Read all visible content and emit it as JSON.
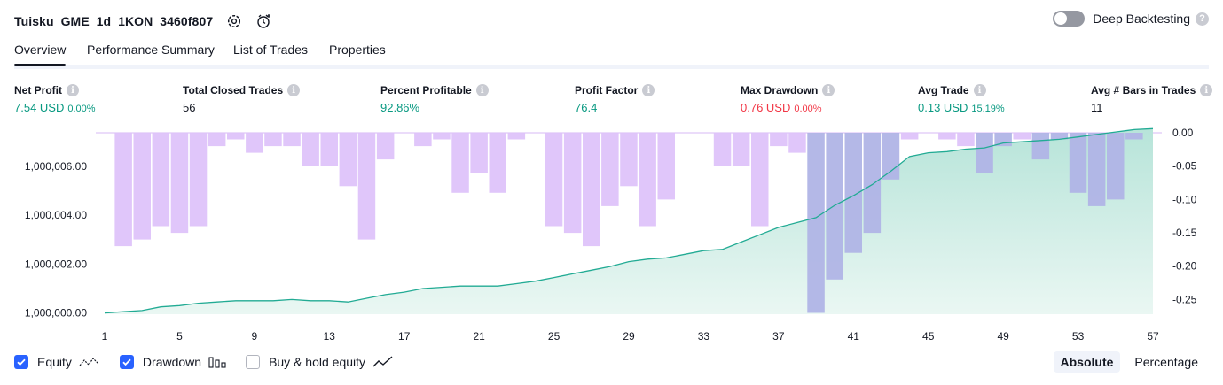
{
  "header": {
    "title": "Tuisku_GME_1d_1KON_3460f807",
    "settings_icon": "gear-icon",
    "replay_icon": "add-alert-clock-icon",
    "deep_backtesting_label": "Deep Backtesting",
    "deep_backtesting_enabled": false,
    "help_icon_text": "?"
  },
  "tabs": [
    {
      "label": "Overview",
      "active": true
    },
    {
      "label": "Performance Summary",
      "active": false
    },
    {
      "label": "List of Trades",
      "active": false
    },
    {
      "label": "Properties",
      "active": false
    }
  ],
  "info_icon_text": "i",
  "metrics": [
    {
      "label": "Net Profit",
      "value": "7.54 USD",
      "pct": "0.00%",
      "color": "green"
    },
    {
      "label": "Total Closed Trades",
      "value": "56",
      "pct": "",
      "color": "dark"
    },
    {
      "label": "Percent Profitable",
      "value": "92.86%",
      "pct": "",
      "color": "green"
    },
    {
      "label": "Profit Factor",
      "value": "76.4",
      "pct": "",
      "color": "green"
    },
    {
      "label": "Max Drawdown",
      "value": "0.76 USD",
      "pct": "0.00%",
      "color": "red"
    },
    {
      "label": "Avg Trade",
      "value": "0.13 USD",
      "pct": "15.19%",
      "color": "green"
    },
    {
      "label": "Avg # Bars in Trades",
      "value": "11",
      "pct": "",
      "color": "dark"
    }
  ],
  "colors": {
    "equity_line": "#22ab94",
    "equity_fill_top": "#b7e4d9",
    "equity_fill_bottom": "#eaf7f3",
    "drawdown_bar": "#dec3fa",
    "drawdown_overlap": "#b0b4e6",
    "accent": "#2962ff",
    "green": "#089981",
    "red": "#f23645"
  },
  "chart_data": {
    "type": "bar+area",
    "x_ticks": [
      "1",
      "5",
      "9",
      "13",
      "17",
      "21",
      "25",
      "29",
      "33",
      "37",
      "41",
      "45",
      "49",
      "53",
      "57"
    ],
    "left_axis": {
      "ticks": [
        "1,000,006.00",
        "1,000,004.00",
        "1,000,002.00",
        "1,000,000.00"
      ],
      "tick_values": [
        1000006,
        1000004,
        1000002,
        1000000
      ],
      "range": [
        999999.95,
        1000007.55
      ]
    },
    "right_axis": {
      "ticks": [
        "0.00",
        "-0.05",
        "-0.10",
        "-0.15",
        "-0.20",
        "-0.25"
      ],
      "tick_values": [
        0,
        -0.05,
        -0.1,
        -0.15,
        -0.2,
        -0.25
      ],
      "range": [
        -0.272,
        0.0
      ]
    },
    "trade_x": [
      1,
      2,
      3,
      4,
      5,
      6,
      7,
      8,
      9,
      10,
      11,
      12,
      13,
      14,
      15,
      16,
      17,
      18,
      19,
      20,
      21,
      22,
      23,
      24,
      25,
      26,
      27,
      28,
      29,
      30,
      31,
      32,
      33,
      34,
      35,
      36,
      37,
      38,
      39,
      40,
      41,
      42,
      43,
      44,
      45,
      46,
      47,
      48,
      49,
      50,
      51,
      52,
      53,
      54,
      55,
      56,
      57
    ],
    "equity": [
      1000000.0,
      1000000.05,
      1000000.1,
      1000000.25,
      1000000.3,
      1000000.4,
      1000000.45,
      1000000.5,
      1000000.5,
      1000000.5,
      1000000.55,
      1000000.5,
      1000000.5,
      1000000.45,
      1000000.6,
      1000000.75,
      1000000.85,
      1000001.0,
      1000001.05,
      1000001.1,
      1000001.1,
      1000001.1,
      1000001.2,
      1000001.3,
      1000001.45,
      1000001.6,
      1000001.75,
      1000001.9,
      1000002.1,
      1000002.2,
      1000002.25,
      1000002.4,
      1000002.55,
      1000002.6,
      1000002.9,
      1000003.2,
      1000003.5,
      1000003.7,
      1000003.9,
      1000004.4,
      1000004.8,
      1000005.25,
      1000005.8,
      1000006.4,
      1000006.55,
      1000006.6,
      1000006.7,
      1000006.75,
      1000006.95,
      1000007.0,
      1000007.05,
      1000007.1,
      1000007.2,
      1000007.3,
      1000007.4,
      1000007.5,
      1000007.54
    ],
    "drawdown": [
      0,
      -0.17,
      -0.16,
      -0.14,
      -0.15,
      -0.14,
      -0.02,
      -0.01,
      -0.03,
      -0.02,
      -0.02,
      -0.05,
      -0.05,
      -0.08,
      -0.16,
      -0.04,
      0,
      -0.02,
      -0.01,
      -0.09,
      -0.06,
      -0.09,
      -0.01,
      0,
      -0.14,
      -0.15,
      -0.17,
      -0.11,
      -0.08,
      -0.14,
      -0.1,
      0,
      0,
      -0.05,
      -0.05,
      -0.14,
      -0.02,
      -0.03,
      -0.27,
      -0.22,
      -0.18,
      -0.15,
      -0.07,
      -0.01,
      0,
      -0.01,
      -0.02,
      -0.06,
      -0.02,
      -0.01,
      -0.04,
      -0.01,
      -0.09,
      -0.11,
      -0.1,
      -0.01,
      0
    ],
    "series": [
      {
        "name": "Equity",
        "type": "area"
      },
      {
        "name": "Drawdown",
        "type": "bar"
      }
    ]
  },
  "legend": {
    "equity": {
      "label": "Equity",
      "checked": true
    },
    "drawdown": {
      "label": "Drawdown",
      "checked": true
    },
    "buy_hold": {
      "label": "Buy & hold equity",
      "checked": false
    }
  },
  "modes": [
    {
      "label": "Absolute",
      "active": true
    },
    {
      "label": "Percentage",
      "active": false
    }
  ]
}
